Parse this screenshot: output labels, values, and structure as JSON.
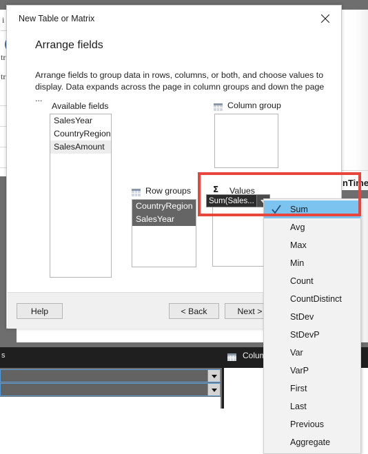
{
  "dialog": {
    "title": "New Table or Matrix",
    "close_icon": "close-icon",
    "heading": "Arrange fields",
    "description": "Arrange fields to group data in rows, columns, or both, and choose values to display. Data expands across the page in column groups and down the page ...",
    "sections": {
      "available_fields": {
        "label": "Available fields",
        "items": [
          {
            "label": "SalesYear",
            "state": "normal"
          },
          {
            "label": "CountryRegion",
            "state": "normal"
          },
          {
            "label": "SalesAmount",
            "state": "highlighted"
          }
        ]
      },
      "column_groups": {
        "label": "Column group",
        "icon": "table-grid-icon",
        "items": []
      },
      "row_groups": {
        "label": "Row groups",
        "icon": "table-grid-icon",
        "items": [
          {
            "label": "CountryRegion",
            "state": "selected"
          },
          {
            "label": "SalesYear",
            "state": "selected"
          }
        ]
      },
      "values": {
        "label": "Values",
        "icon": "sigma-icon",
        "chip": {
          "text": "Sum(Sales...",
          "dropdown_icon": "chevron-down-icon"
        }
      }
    },
    "footer": {
      "help_label": "Help",
      "back_label": "< Back",
      "next_label": "Next >"
    }
  },
  "aggregate_menu": {
    "selected": "Sum",
    "check_icon": "checkmark-icon",
    "items": [
      "Sum",
      "Avg",
      "Max",
      "Min",
      "Count",
      "CountDistinct",
      "StDev",
      "StDevP",
      "Var",
      "VarP",
      "First",
      "Last",
      "Previous",
      "Aggregate"
    ]
  },
  "annotation": {
    "type": "red-rectangle-highlight",
    "color": "#e8453c"
  },
  "background": {
    "right_fragment_text": "nTime",
    "bottom_panel": {
      "left_label": "s",
      "column_label": "Colum",
      "column_icon": "table-grid-icon",
      "rows": [
        {
          "dropdown_icon": "caret-down-icon"
        },
        {
          "dropdown_icon": "caret-down-icon"
        }
      ]
    },
    "left_fragments": [
      {
        "text": "i"
      },
      {
        "text": "tr"
      },
      {
        "text": "tr"
      }
    ]
  },
  "colors": {
    "accent_selection": "#7cc3f0",
    "annotation_red": "#e8453c",
    "chip_dark": "#2b2b2b",
    "row_selected": "#656565",
    "window_gray": "#6e6e6e"
  }
}
